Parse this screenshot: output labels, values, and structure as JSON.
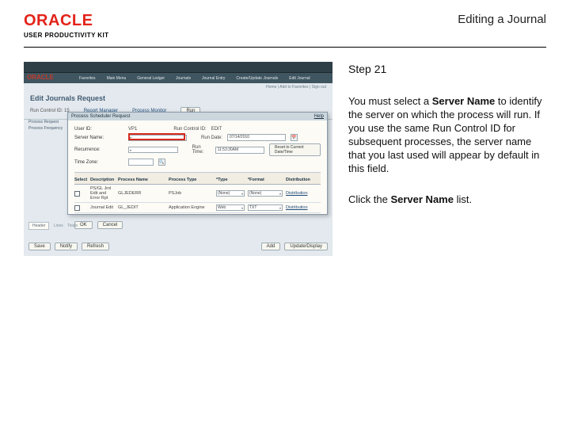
{
  "header": {
    "logo_text": "ORACLE",
    "logo_sub": "USER PRODUCTIVITY KIT",
    "title": "Editing a Journal"
  },
  "instructions": {
    "step_label": "Step 21",
    "para1_a": "You must select a ",
    "para1_bold": "Server Name",
    "para1_b": " to identify the server on which the process will run. If you use the same Run Control ID for subsequent processes, the server name that you last used will appear by default in this field.",
    "para2_a": "Click the ",
    "para2_bold": "Server Name",
    "para2_b": " list."
  },
  "app": {
    "brand": "ORACLE",
    "nav": [
      "Favorites",
      "Main Menu",
      "General Ledger",
      "Journals",
      "Journal Entry",
      "Create/Update Journals",
      "Edit Journal"
    ],
    "breadcrumb": "Home | Add to Favorites | Sign out",
    "page_title": "Edit Journals Request",
    "run_control_label": "Run Control ID:",
    "run_control_value": "15",
    "report_manager": "Report Manager",
    "process_monitor": "Process Monitor",
    "run_btn": "Run",
    "side_labels": [
      "Process Request",
      "Process Frequency"
    ],
    "modal": {
      "title": "Process Scheduler Request",
      "help": "Help",
      "user_label": "User ID:",
      "user_value": "VP1",
      "runctl_label": "Run Control ID:",
      "runctl_value": "EDIT",
      "server_label": "Server Name:",
      "run_date_label": "Run Date:",
      "run_date_value": "07/14/2010",
      "recurrence_label": "Recurrence:",
      "run_time_label": "Run Time:",
      "run_time_value": "11:53:30AM",
      "reset_btn": "Reset to Current Date/Time",
      "timezone_label": "Time Zone:",
      "proc_header": [
        "Select",
        "Description",
        "Process Name",
        "Process Type",
        "*Type",
        "*Format",
        "Distribution"
      ],
      "rows": [
        {
          "desc": "PS/GL Jrnl Edit and Error Rpt",
          "name": "GLJEDERR",
          "type": "PSJob",
          "typ": "(None)",
          "fmt": "(None)",
          "dist": "Distribution"
        },
        {
          "desc": "Journal Edit",
          "name": "GL_JEDIT",
          "type": "Application Engine",
          "typ": "Web",
          "fmt": "TXT",
          "dist": "Distribution"
        }
      ],
      "ok": "OK",
      "cancel": "Cancel"
    },
    "tabs": {
      "on": "Header",
      "off1": "Lines",
      "off2": "Totals"
    },
    "footer": {
      "save": "Save",
      "notify": "Notify",
      "refresh": "Refresh",
      "add": "Add",
      "update": "Update/Display"
    }
  }
}
